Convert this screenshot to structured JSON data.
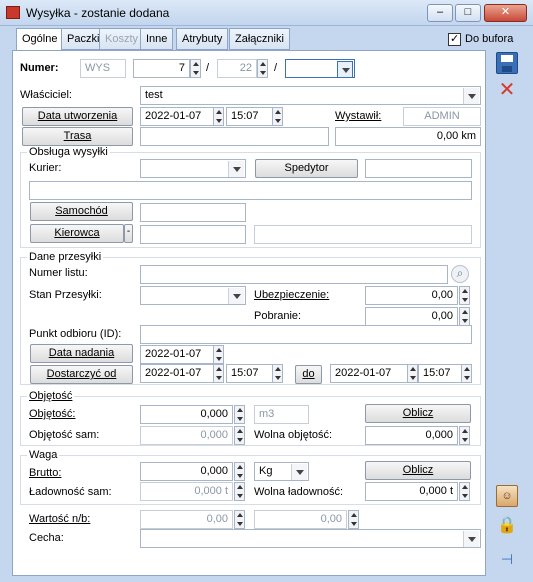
{
  "window": {
    "title": "Wysyłka - zostanie dodana"
  },
  "tabs": [
    {
      "label": "Ogólne"
    },
    {
      "label": "Paczki"
    },
    {
      "label": "Koszty"
    },
    {
      "label": "Inne"
    },
    {
      "label": "Atrybuty"
    },
    {
      "label": "Załączniki"
    }
  ],
  "do_bufora": {
    "label": "Do bufora",
    "checked": true
  },
  "numer": {
    "label": "Numer:",
    "prefix": "WYS",
    "number": "7",
    "month": "22",
    "sep1": "/",
    "sep2": "/",
    "series": ""
  },
  "wlasciciel": {
    "label": "Właściciel:",
    "value": "test"
  },
  "data_utworzenia": {
    "button": "Data utworzenia",
    "date": "2022-01-07",
    "time": "15:07"
  },
  "wystawil": {
    "label": "Wystawił:",
    "value": "ADMIN"
  },
  "trasa": {
    "button": "Trasa",
    "value": "",
    "km": "0,00 km"
  },
  "obsluga": {
    "title": "Obsługa wysyłki",
    "kurier_label": "Kurier:",
    "kurier_value": "",
    "spedytor_button": "Spedytor",
    "spedytor_value": "",
    "samochod_button": "Samochód",
    "samochod_value": "",
    "kierowca_button": "Kierowca",
    "kierowca_dash": "-",
    "kierowca_value": ""
  },
  "dane": {
    "title": "Dane przesyłki",
    "numer_listu_label": "Numer listu:",
    "stan_label": "Stan Przesyłki:",
    "ubezpieczenie_label": "Ubezpieczenie:",
    "ubezpieczenie_value": "0,00",
    "pobranie_label": "Pobranie:",
    "pobranie_value": "0,00",
    "punkt_label": "Punkt odbioru (ID):",
    "data_nadania_button": "Data nadania",
    "data_nadania_value": "2022-01-07",
    "dostarczyc_button": "Dostarczyć od",
    "dostarczyc_date": "2022-01-07",
    "dostarczyc_time": "15:07",
    "do_button": "do",
    "do_date": "2022-01-07",
    "do_time": "15:07"
  },
  "objetosc": {
    "title": "Objętość",
    "label": "Objętość:",
    "value": "0,000",
    "unit": "m3",
    "oblicz": "Oblicz",
    "sam_label": "Objętość sam:",
    "sam_value": "0,000",
    "wolna_label": "Wolna objętość:",
    "wolna_value": "0,000"
  },
  "waga": {
    "title": "Waga",
    "brutto_label": "Brutto:",
    "brutto_value": "0,000",
    "unit": "Kg",
    "oblicz": "Oblicz",
    "ladownosc_sam_label": "Ładowność sam:",
    "ladownosc_sam_value": "0,000 t",
    "wolna_label": "Wolna ładowność:",
    "wolna_value": "0,000 t"
  },
  "wartosc": {
    "label": "Wartość n/b:",
    "value1": "0,00",
    "value2": "0,00"
  },
  "cecha": {
    "label": "Cecha:",
    "value": ""
  },
  "colors": {
    "accent": "#3d6fb5",
    "window_bg": "#c5d7ee",
    "close_red": "#c9483a"
  }
}
